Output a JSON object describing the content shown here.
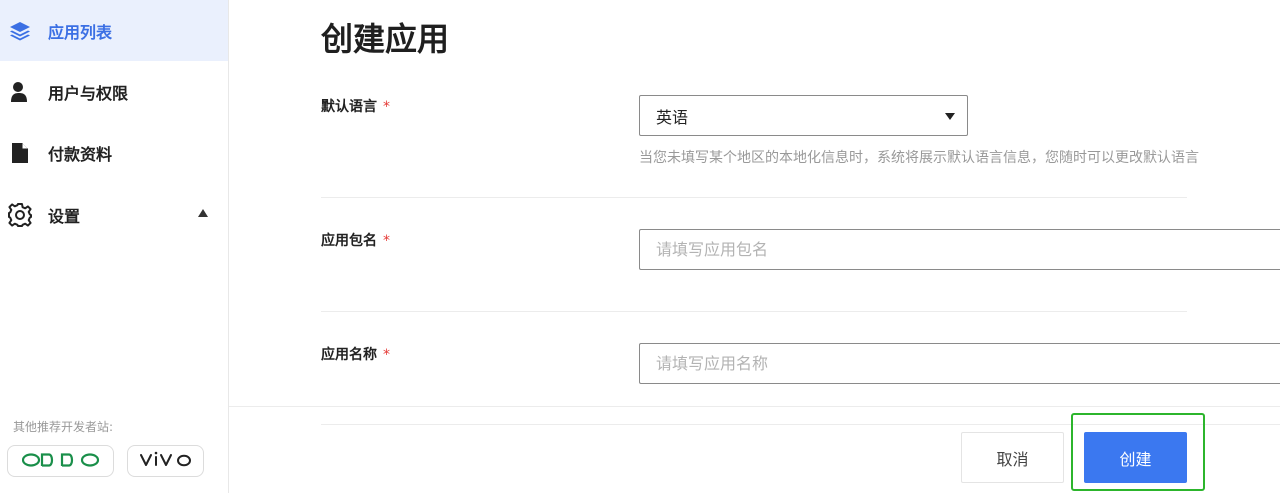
{
  "sidebar": {
    "items": [
      {
        "label": "应用列表",
        "icon": "layers-icon",
        "active": true
      },
      {
        "label": "用户与权限",
        "icon": "user-icon"
      },
      {
        "label": "付款资料",
        "icon": "document-icon"
      },
      {
        "label": "设置",
        "icon": "gear-icon"
      }
    ],
    "recommend_label": "其他推荐开发者站:",
    "partners": [
      "oppo",
      "vivo"
    ]
  },
  "main": {
    "title": "创建应用",
    "language": {
      "label": "默认语言",
      "required_mark": "*",
      "value": "英语",
      "hint": "当您未填写某个地区的本地化信息时，系统将展示默认语言信息，您随时可以更改默认语言"
    },
    "package": {
      "label": "应用包名",
      "required_mark": "*",
      "value": "",
      "placeholder": "请填写应用包名"
    },
    "app_name": {
      "label": "应用名称",
      "required_mark": "*",
      "value": "",
      "placeholder": "请填写应用名称"
    }
  },
  "footer": {
    "cancel_label": "取消",
    "create_label": "创建"
  },
  "colors": {
    "accent": "#3b78f0",
    "active_bg": "#eaf0fd",
    "highlight_border": "#2cb52c",
    "required": "#e53935",
    "oppo_green": "#1a8f4a"
  }
}
